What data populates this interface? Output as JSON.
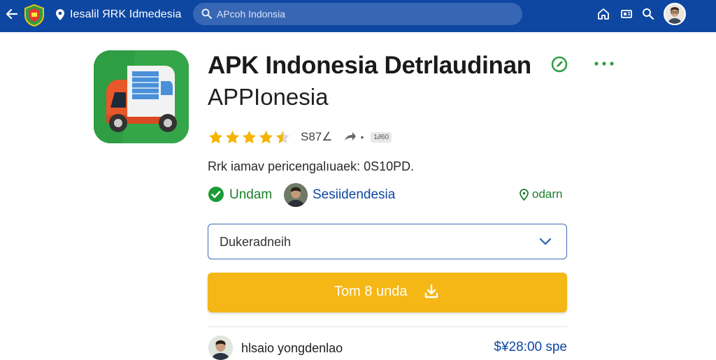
{
  "header": {
    "title": "Iesalil ЯRK Idmedesia",
    "search_placeholder": "APcoh Indonsia",
    "icons": [
      "back-arrow-icon",
      "shield-logo-icon",
      "location-pin-icon",
      "search-icon",
      "home-icon",
      "news-icon",
      "search-icon",
      "avatar"
    ]
  },
  "app": {
    "name": "APK Indonesia Detrlaudinan",
    "subtitle": "APPIonesia",
    "rating_stars": 4.5,
    "rating_count": "S87∠",
    "badge": "1∂60",
    "description": "Rrk iamav pericengalıuaek: 0S10PD.",
    "status": "Undam",
    "developer": "Sesiidendesia",
    "location": "odarn"
  },
  "select": {
    "value": "Dukeradneih"
  },
  "install_button": {
    "label": "Tom 8 unda"
  },
  "bottom": {
    "name": "hlsaio yongdenlao",
    "price": "$¥28:00 spe"
  },
  "colors": {
    "header_bg": "#0d47a1",
    "accent_green": "#1b7f2b",
    "link_blue": "#0d47a1",
    "button_yellow": "#f4b715",
    "star": "#f5b400"
  }
}
